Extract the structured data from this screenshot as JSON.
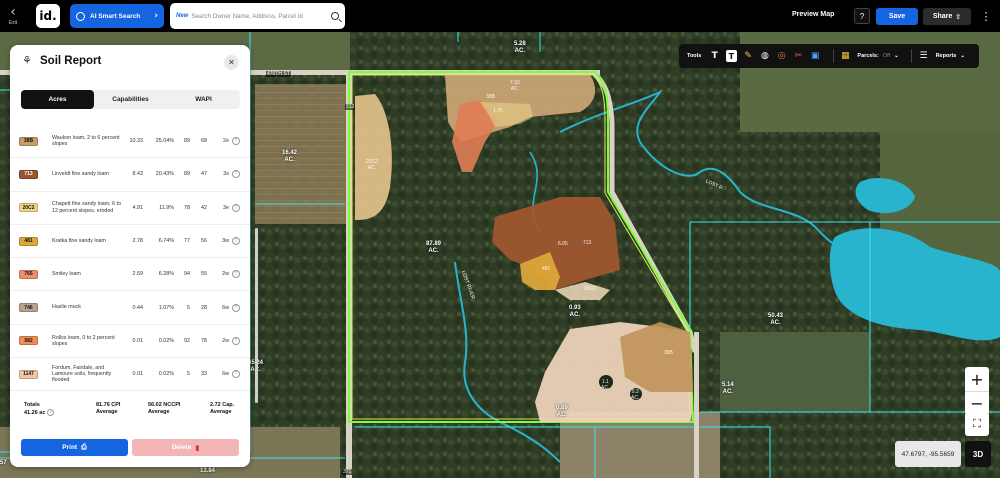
{
  "topbar": {
    "exit_label": "Exit",
    "logo_text": "id.",
    "ai_search_label": "AI Smart Search",
    "search_new_label": "New",
    "search_placeholder": "Search Owner Name, Address, Parcel Id",
    "preview_map_label": "Preview Map",
    "help_label": "?",
    "save_label": "Save",
    "share_label": "Share",
    "more_label": "⋮"
  },
  "tools": {
    "tools_label": "Tools",
    "parcels_label": "Parcels:",
    "parcels_state": "Off",
    "reports_label": "Reports"
  },
  "panel": {
    "title": "Soil Report",
    "tabs": [
      {
        "label": "Acres",
        "active": true
      },
      {
        "label": "Capabilities",
        "active": false
      },
      {
        "label": "WAPI",
        "active": false
      }
    ],
    "rows": [
      {
        "code": "38B",
        "color": "#c79e6b",
        "desc": "Waukon loam, 2 to 6 percent slopes",
        "acres": "10.33",
        "pct": "25.04%",
        "v1": "89",
        "v2": "68",
        "cap": "2e"
      },
      {
        "code": "713",
        "color": "#9a5530",
        "desc": "Linveldt fine sandy loam",
        "acres": "8.43",
        "pct": "20.43%",
        "v1": "89",
        "v2": "47",
        "cap": "3s"
      },
      {
        "code": "20C2",
        "color": "#edd58a",
        "desc": "Chapett fine sandy loam, 6 to 12 percent slopes, eroded",
        "acres": "4.91",
        "pct": "11.9%",
        "v1": "78",
        "v2": "42",
        "cap": "3e"
      },
      {
        "code": "481",
        "color": "#e0a83a",
        "desc": "Kratka fine sandy loam",
        "acres": "2.78",
        "pct": "6.74%",
        "v1": "77",
        "v2": "56",
        "cap": "3w"
      },
      {
        "code": "765",
        "color": "#ee8e6a",
        "desc": "Smiley loam",
        "acres": "2.59",
        "pct": "6.28%",
        "v1": "94",
        "v2": "55",
        "cap": "2w"
      },
      {
        "code": "746",
        "color": "#b8a38c",
        "desc": "Haslie muck",
        "acres": "0.44",
        "pct": "1.07%",
        "v1": "5",
        "v2": "28",
        "cap": "6w"
      },
      {
        "code": "582",
        "color": "#f08c5a",
        "desc": "Rollss loam, 0 to 2 percent slopes",
        "acres": "0.01",
        "pct": "0.02%",
        "v1": "92",
        "v2": "78",
        "cap": "2w"
      },
      {
        "code": "1147",
        "color": "#f2c6a8",
        "desc": "Fordum, Fairdale, and Lamoure soils, frequently flooded",
        "acres": "0.01",
        "pct": "0.02%",
        "v1": "5",
        "v2": "33",
        "cap": "6w"
      }
    ],
    "totals": {
      "label": "Totals",
      "acres": "41.26 ac",
      "cpi": "81.76 CPI",
      "cpi_sub": "Average",
      "nccpi": "56.02 NCCPI",
      "nccpi_sub": "Average",
      "cap": "2.72 Cap.",
      "cap_sub": "Average"
    },
    "print_label": "Print",
    "delete_label": "Delete"
  },
  "map": {
    "labels": {
      "a528": "5.28\nAC.",
      "a1642": "16.42\nAC.",
      "a8789": "87.89\nAC.",
      "a093": "0.93\nAC.",
      "a5043": "50.43\nAC.",
      "a6524": "65.24\nAC.",
      "a514": "5.14\nAC.",
      "a089": "0.89\nAC.",
      "a1384": "13.84",
      "a57": "57"
    },
    "road_labels": {
      "r470": "470TH ST",
      "r313": "313",
      "r371": "371",
      "lost_river": "LOST RIVER",
      "lost_river2": "LOST R"
    },
    "soil_labels": {
      "s733": "7.33\nAC.",
      "s38b": "38B",
      "s176": "1.76",
      "s20c2": "20C2\nAC.",
      "s713": "713",
      "s481": "481",
      "s20c2b": "20C2",
      "s38b2": "38B",
      "s11": "1.1\nAC.",
      "s03": "0.3\nAC.",
      "s605": "6.05"
    },
    "coords": "47.6797, -95.5659",
    "btn3d": "3D",
    "zoom_in": "+",
    "zoom_out": "−"
  }
}
